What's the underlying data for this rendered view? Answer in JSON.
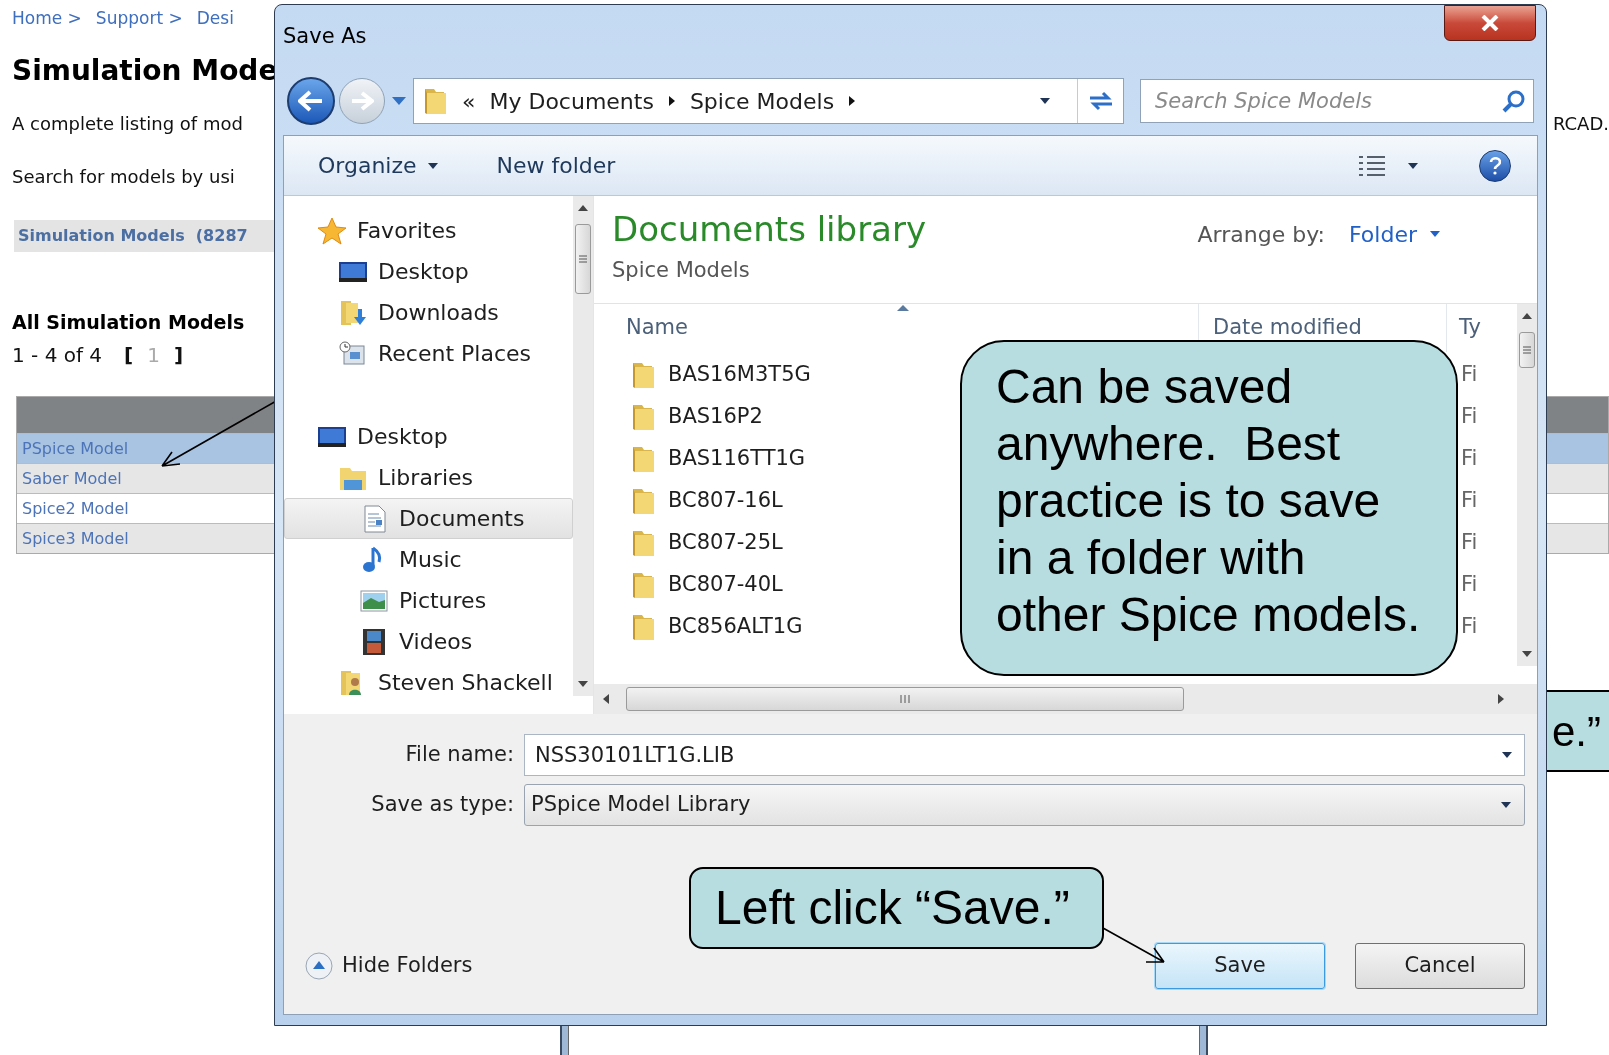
{
  "web_page": {
    "breadcrumb": [
      "Home >",
      "Support >",
      "Desi"
    ],
    "title": "Simulation Mode",
    "intro": "A complete listing of mod",
    "intro_tail": "RCAD.",
    "search_hint": "Search for models by usi",
    "category": "Simulation Models  (8287",
    "section_title": "All Simulation Models",
    "pager": {
      "range": "1 - 4 of 4",
      "open": "[",
      "page": "1",
      "close": "]"
    },
    "models": [
      {
        "label": "PSpice Model",
        "selected": true
      },
      {
        "label": "Saber Model",
        "selected": false
      },
      {
        "label": "Spice2 Model",
        "selected": false
      },
      {
        "label": "Spice3 Model",
        "selected": false
      }
    ]
  },
  "behind_callout": {
    "text": "e.”"
  },
  "dialog": {
    "title": "Save As",
    "address": {
      "overflow": "«",
      "crumbs": [
        "My Documents",
        "Spice Models"
      ]
    },
    "search": {
      "placeholder": "Search Spice Models"
    },
    "toolbar": {
      "organize": "Organize",
      "new_folder": "New folder"
    },
    "nav_tree": [
      {
        "label": "Favorites",
        "kind": "star",
        "selected": false,
        "children": [
          {
            "label": "Desktop",
            "kind": "monitor",
            "selected": false
          },
          {
            "label": "Downloads",
            "kind": "download",
            "selected": false
          },
          {
            "label": "Recent Places",
            "kind": "recent",
            "selected": false
          }
        ]
      },
      {
        "label": "Desktop",
        "kind": "monitor",
        "selected": false,
        "children": [
          {
            "label": "Libraries",
            "kind": "library",
            "selected": false,
            "children": [
              {
                "label": "Documents",
                "kind": "document",
                "selected": true
              },
              {
                "label": "Music",
                "kind": "music",
                "selected": false
              },
              {
                "label": "Pictures",
                "kind": "pictures",
                "selected": false
              },
              {
                "label": "Videos",
                "kind": "video",
                "selected": false
              }
            ]
          },
          {
            "label": "Steven Shackell",
            "kind": "user",
            "selected": false
          }
        ]
      }
    ],
    "library": {
      "title": "Documents library",
      "subtitle": "Spice Models",
      "arrange_label": "Arrange by:",
      "arrange_value": "Folder"
    },
    "columns": [
      "Name",
      "Date modified",
      "Ty"
    ],
    "files": [
      {
        "name": "BAS16M3T5G",
        "type": "Fi"
      },
      {
        "name": "BAS16P2",
        "type": "Fi"
      },
      {
        "name": "BAS116TT1G",
        "type": "Fi"
      },
      {
        "name": "BC807-16L",
        "type": "Fi"
      },
      {
        "name": "BC807-25L",
        "type": "Fi"
      },
      {
        "name": "BC807-40L",
        "type": "Fi"
      },
      {
        "name": "BC856ALT1G",
        "type": "Fi"
      }
    ],
    "file_name": {
      "label": "File name:",
      "value": "NSS30101LT1G.LIB"
    },
    "save_type": {
      "label": "Save as type:",
      "value": "PSpice Model Library"
    },
    "hide_folders": "Hide Folders",
    "buttons": [
      {
        "label": "Save",
        "default": true
      },
      {
        "label": "Cancel",
        "default": false
      }
    ]
  },
  "callouts": [
    {
      "text": "Can be saved anywhere.  Best practice is to save in a folder with other Spice models."
    },
    {
      "text": "Left click “Save.”"
    }
  ]
}
